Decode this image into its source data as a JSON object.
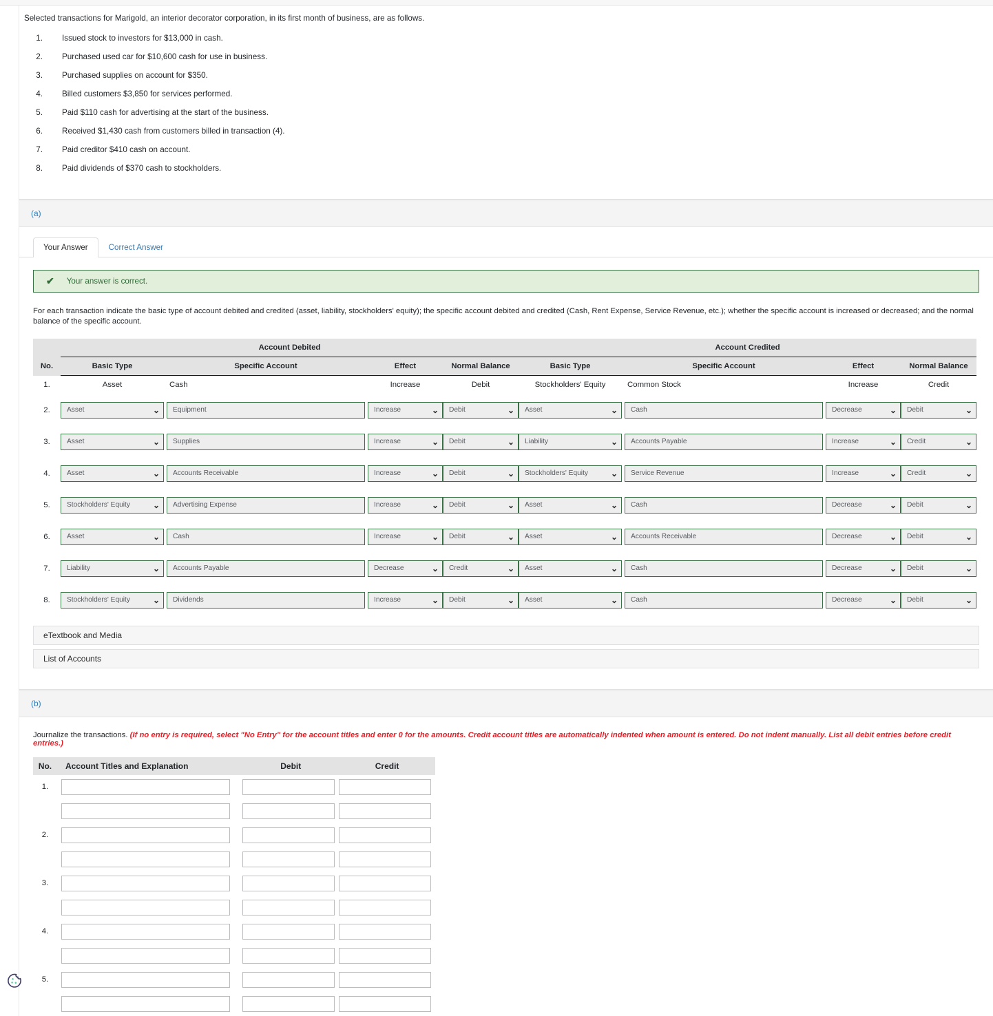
{
  "problem": {
    "intro": "Selected transactions for Marigold, an interior decorator corporation, in its first month of business, are as follows.",
    "transactions": [
      {
        "num": "1.",
        "text": "Issued stock to investors for $13,000 in cash."
      },
      {
        "num": "2.",
        "text": "Purchased used car for $10,600 cash for use in business."
      },
      {
        "num": "3.",
        "text": "Purchased supplies on account for $350."
      },
      {
        "num": "4.",
        "text": "Billed customers $3,850 for services performed."
      },
      {
        "num": "5.",
        "text": "Paid $110 cash for advertising at the start of the business."
      },
      {
        "num": "6.",
        "text": "Received $1,430 cash from customers billed in transaction (4)."
      },
      {
        "num": "7.",
        "text": "Paid creditor $410 cash on account."
      },
      {
        "num": "8.",
        "text": "Paid dividends of $370 cash to stockholders."
      }
    ]
  },
  "part_a": {
    "label": "(a)",
    "tabs": [
      {
        "label": "Your Answer",
        "active": true
      },
      {
        "label": "Correct Answer",
        "active": false
      }
    ],
    "banner": {
      "icon": "check-icon",
      "text": "Your answer is correct."
    },
    "instruction": "For each transaction indicate the basic type of account debited and credited (asset, liability, stockholders' equity); the specific account debited and credited (Cash, Rent Expense, Service Revenue, etc.); whether the specific account is increased or decreased; and the normal balance of the specific account.",
    "table": {
      "group_headers": {
        "debited": "Account Debited",
        "credited": "Account Credited"
      },
      "columns": {
        "no": "No.",
        "basic_type": "Basic Type",
        "specific_account": "Specific Account",
        "effect": "Effect",
        "normal_balance": "Normal Balance"
      },
      "rows": [
        {
          "no": "1.",
          "readonly": true,
          "debit": {
            "basic_type": "Asset",
            "specific_account": "Cash",
            "effect": "Increase",
            "normal_balance": "Debit"
          },
          "credit": {
            "basic_type": "Stockholders' Equity",
            "specific_account": "Common Stock",
            "effect": "Increase",
            "normal_balance": "Credit"
          }
        },
        {
          "no": "2.",
          "readonly": false,
          "debit": {
            "basic_type": "Asset",
            "specific_account": "Equipment",
            "effect": "Increase",
            "normal_balance": "Debit"
          },
          "credit": {
            "basic_type": "Asset",
            "specific_account": "Cash",
            "effect": "Decrease",
            "normal_balance": "Debit"
          }
        },
        {
          "no": "3.",
          "readonly": false,
          "debit": {
            "basic_type": "Asset",
            "specific_account": "Supplies",
            "effect": "Increase",
            "normal_balance": "Debit"
          },
          "credit": {
            "basic_type": "Liability",
            "specific_account": "Accounts Payable",
            "effect": "Increase",
            "normal_balance": "Credit"
          }
        },
        {
          "no": "4.",
          "readonly": false,
          "debit": {
            "basic_type": "Asset",
            "specific_account": "Accounts Receivable",
            "effect": "Increase",
            "normal_balance": "Debit"
          },
          "credit": {
            "basic_type": "Stockholders' Equity",
            "specific_account": "Service Revenue",
            "effect": "Increase",
            "normal_balance": "Credit"
          }
        },
        {
          "no": "5.",
          "readonly": false,
          "debit": {
            "basic_type": "Stockholders' Equity",
            "specific_account": "Advertising Expense",
            "effect": "Increase",
            "normal_balance": "Debit"
          },
          "credit": {
            "basic_type": "Asset",
            "specific_account": "Cash",
            "effect": "Decrease",
            "normal_balance": "Debit"
          }
        },
        {
          "no": "6.",
          "readonly": false,
          "debit": {
            "basic_type": "Asset",
            "specific_account": "Cash",
            "effect": "Increase",
            "normal_balance": "Debit"
          },
          "credit": {
            "basic_type": "Asset",
            "specific_account": "Accounts Receivable",
            "effect": "Decrease",
            "normal_balance": "Debit"
          }
        },
        {
          "no": "7.",
          "readonly": false,
          "debit": {
            "basic_type": "Liability",
            "specific_account": "Accounts Payable",
            "effect": "Decrease",
            "normal_balance": "Credit"
          },
          "credit": {
            "basic_type": "Asset",
            "specific_account": "Cash",
            "effect": "Decrease",
            "normal_balance": "Debit"
          }
        },
        {
          "no": "8.",
          "readonly": false,
          "debit": {
            "basic_type": "Stockholders' Equity",
            "specific_account": "Dividends",
            "effect": "Increase",
            "normal_balance": "Debit"
          },
          "credit": {
            "basic_type": "Asset",
            "specific_account": "Cash",
            "effect": "Decrease",
            "normal_balance": "Debit"
          }
        }
      ]
    },
    "buttons": {
      "etextbook": "eTextbook and Media",
      "list_of_accounts": "List of Accounts"
    }
  },
  "part_b": {
    "label": "(b)",
    "instruction_plain": "Journalize the transactions. ",
    "instruction_emphasis": "(If no entry is required, select \"No Entry\" for the account titles and enter 0 for the amounts. Credit account titles are automatically indented when amount is entered. Do not indent manually. List all debit entries before credit entries.)",
    "journal": {
      "columns": {
        "no": "No.",
        "titles": "Account Titles and Explanation",
        "debit": "Debit",
        "credit": "Credit"
      },
      "rows": [
        {
          "no": "1.",
          "account": "",
          "debit": "",
          "credit": ""
        },
        {
          "no": "",
          "account": "",
          "debit": "",
          "credit": ""
        },
        {
          "no": "2.",
          "account": "",
          "debit": "",
          "credit": ""
        },
        {
          "no": "",
          "account": "",
          "debit": "",
          "credit": ""
        },
        {
          "no": "3.",
          "account": "",
          "debit": "",
          "credit": ""
        },
        {
          "no": "",
          "account": "",
          "debit": "",
          "credit": ""
        },
        {
          "no": "4.",
          "account": "",
          "debit": "",
          "credit": ""
        },
        {
          "no": "",
          "account": "",
          "debit": "",
          "credit": ""
        },
        {
          "no": "5.",
          "account": "",
          "debit": "",
          "credit": ""
        },
        {
          "no": "",
          "account": "",
          "debit": "",
          "credit": ""
        }
      ]
    }
  },
  "icons": {
    "chevron": "⌄",
    "check": "✔",
    "cookie": "cookie-icon"
  },
  "colors": {
    "link": "#2f7cb8",
    "field_border_green": "#3a7045",
    "field_fill": "#eeeeee",
    "banner_bg": "#e2efda",
    "header_bg": "#e3e3e3",
    "emphasis_red": "#ec1c24"
  }
}
